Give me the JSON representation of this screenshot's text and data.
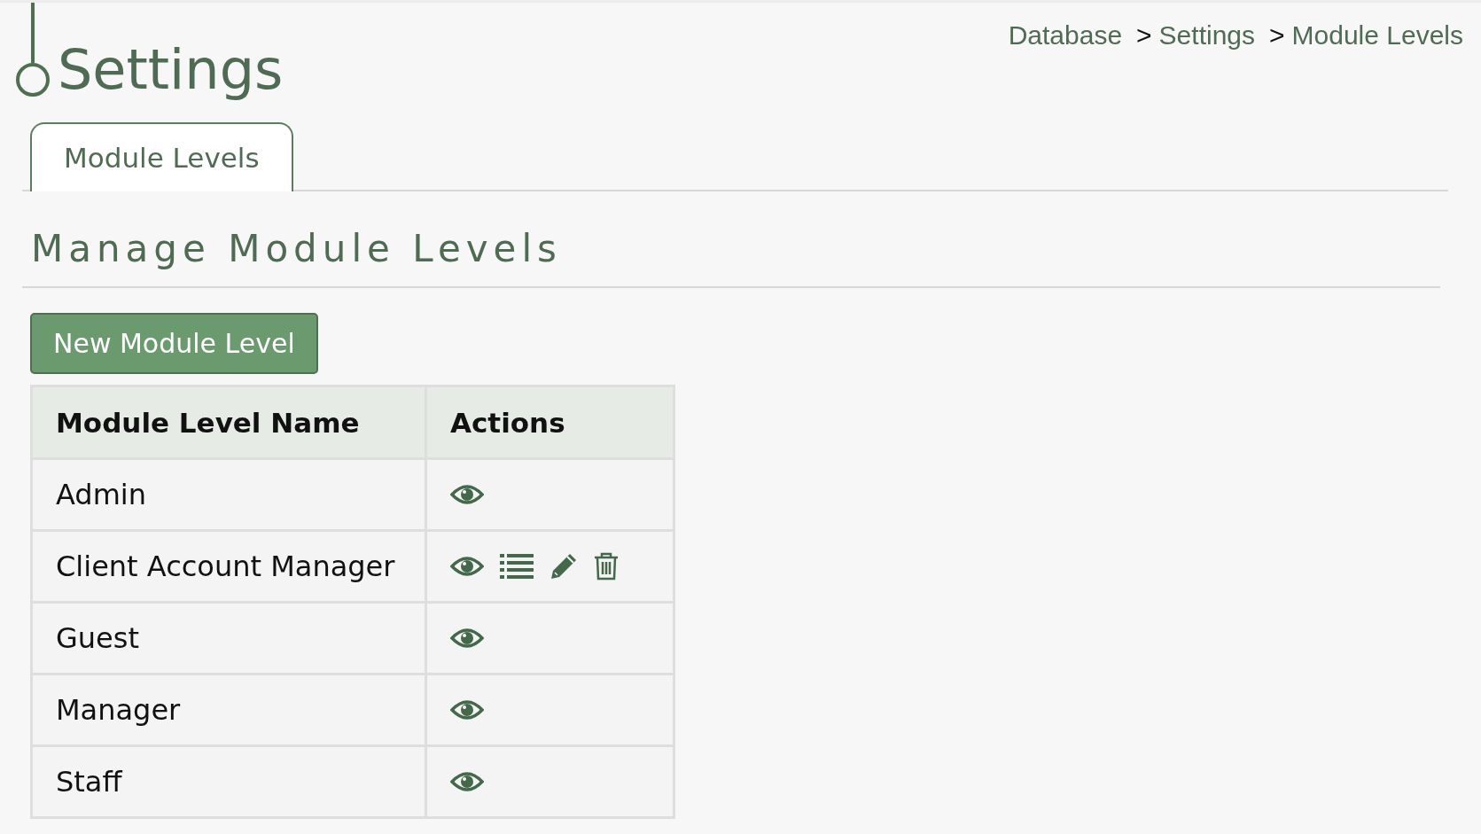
{
  "page_title": "Settings",
  "breadcrumb": {
    "items": [
      "Database",
      "Settings",
      "Module Levels"
    ],
    "separator": ">"
  },
  "tabs": [
    {
      "label": "Module Levels",
      "selected": true
    }
  ],
  "section_title": "Manage Module Levels",
  "new_button": "New Module Level",
  "table": {
    "columns": [
      "Module Level Name",
      "Actions"
    ],
    "rows": [
      {
        "name": "Admin",
        "actions": [
          {
            "kind": "view"
          }
        ]
      },
      {
        "name": "Client Account Manager",
        "actions": [
          {
            "kind": "view"
          },
          {
            "kind": "list"
          },
          {
            "kind": "edit"
          },
          {
            "kind": "delete"
          }
        ]
      },
      {
        "name": "Guest",
        "actions": [
          {
            "kind": "view"
          }
        ]
      },
      {
        "name": "Manager",
        "actions": [
          {
            "kind": "view"
          }
        ]
      },
      {
        "name": "Staff",
        "actions": [
          {
            "kind": "view"
          }
        ]
      }
    ]
  }
}
